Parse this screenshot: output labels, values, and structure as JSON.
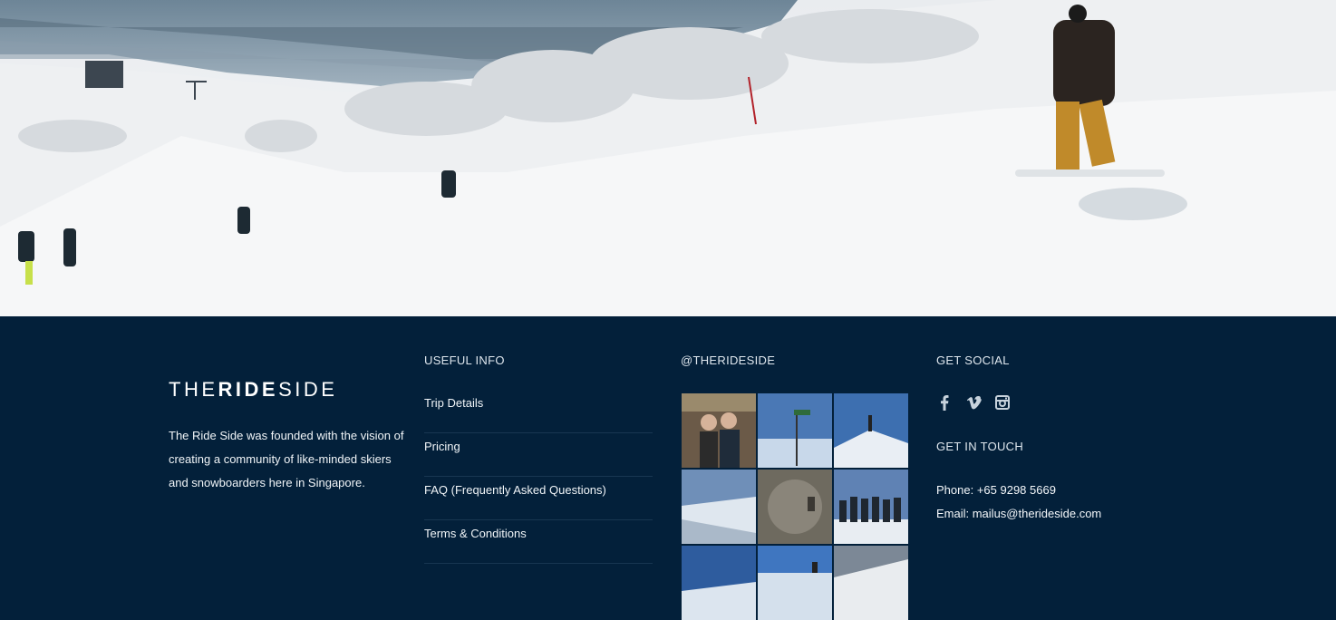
{
  "hero": {
    "icon": "snowy-ski-slope-photo"
  },
  "about": {
    "logo_light_1": "THE",
    "logo_bold": "RIDE",
    "logo_light_2": "SIDE",
    "text": "The Ride Side was founded with the vision of creating a community of like-minded skiers and snowboarders here in Singapore."
  },
  "useful_info": {
    "heading": "USEFUL INFO",
    "links": [
      {
        "label": "Trip Details"
      },
      {
        "label": "Pricing"
      },
      {
        "label": "FAQ (Frequently Asked Questions)"
      },
      {
        "label": "Terms & Conditions"
      }
    ]
  },
  "instagram": {
    "heading": "@THERIDESIDE",
    "tiles": [
      {
        "icon": "instagram-photo"
      },
      {
        "icon": "instagram-photo"
      },
      {
        "icon": "instagram-photo"
      },
      {
        "icon": "instagram-photo"
      },
      {
        "icon": "instagram-photo"
      },
      {
        "icon": "instagram-photo"
      },
      {
        "icon": "instagram-photo"
      },
      {
        "icon": "instagram-photo"
      },
      {
        "icon": "instagram-photo"
      }
    ]
  },
  "social": {
    "heading": "GET SOCIAL",
    "icons": [
      "facebook-icon",
      "vimeo-icon",
      "instagram-icon"
    ],
    "touch_heading": "GET IN TOUCH",
    "phone": "Phone: +65 9298 5669",
    "email": "Email: mailus@therideside.com"
  },
  "colors": {
    "footer_bg": "#03203a",
    "divider": "#183651",
    "text": "#f1f5f8"
  }
}
